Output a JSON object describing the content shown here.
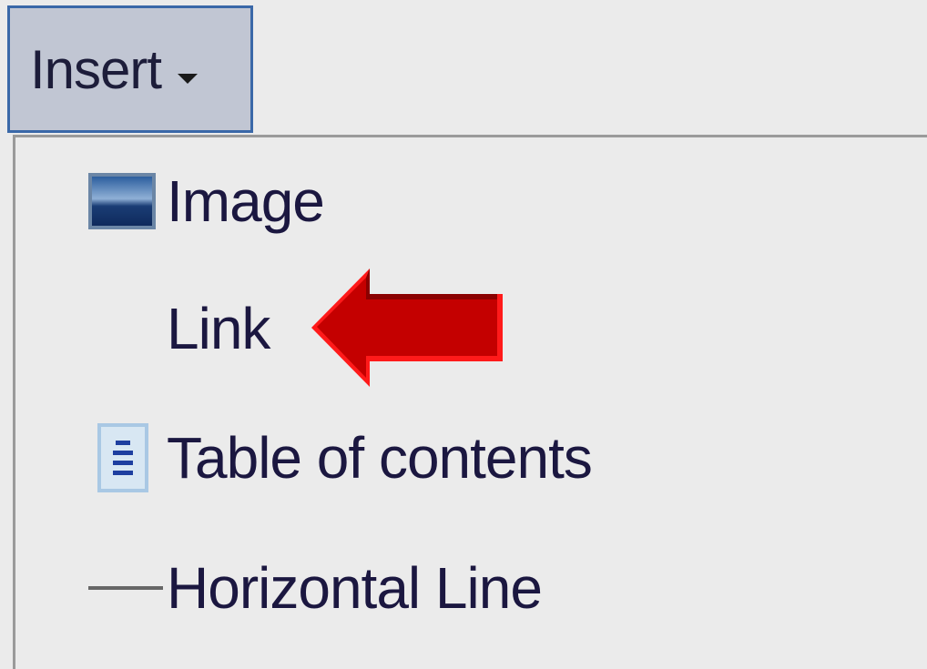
{
  "insert_menu": {
    "button_label": "Insert",
    "items": [
      {
        "label": "Image",
        "icon": "image-icon"
      },
      {
        "label": "Link",
        "icon": ""
      },
      {
        "label": "Table of contents",
        "icon": "table-of-contents-icon"
      },
      {
        "label": "Horizontal Line",
        "icon": "horizontal-line-icon"
      }
    ]
  },
  "colors": {
    "button_background": "#c1c6d3",
    "button_border": "#3a68a8",
    "menu_background": "#ebebeb",
    "arrow": "#d10000",
    "text": "#1b1740"
  }
}
